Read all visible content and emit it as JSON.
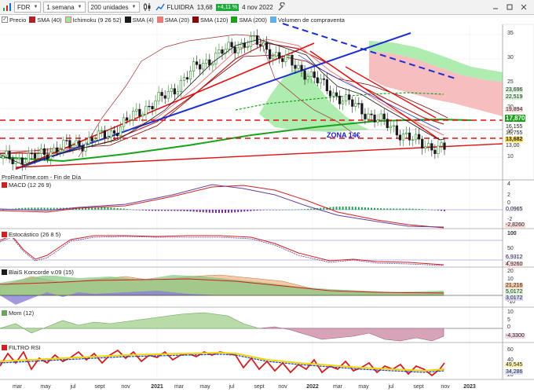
{
  "toolbar": {
    "symbol": "FDR",
    "timeframe": "1 semana",
    "units": "200 unidades",
    "instrument_name": "FLUIDRA",
    "last_price": "13,68",
    "change_pct": "+4,11 %",
    "date": "4 nov 2022"
  },
  "legend": {
    "price": "Precio",
    "sma40": "SMA (40)",
    "ichimoku": "Ichimoku (9 26 52)",
    "sma4": "SMA (4)",
    "sma20": "SMA (20)",
    "sma120": "SMA (120)",
    "sma200": "SMA (200)",
    "volume": "Volumen de compraventa"
  },
  "colors": {
    "candle_up": "#2e8b2e",
    "candle_down": "#1a1a1a",
    "sma4": "#1a1a1a",
    "sma20": "#e87a7a",
    "sma40": "#b22222",
    "sma120": "#8b0000",
    "sma200": "#1aa31a",
    "cloud_green": "#9be79b",
    "cloud_red": "#f5b3b3",
    "trend_red": "#e01010",
    "trend_blue": "#1a2fd0",
    "brand_green": "#1faa3c"
  },
  "annotation": {
    "zona": "ZONA 14€"
  },
  "watermark": "ProRealTime.com - Fin de Día",
  "price_axis": {
    "ticks": [
      "35",
      "30",
      "25",
      "20",
      "15",
      "10"
    ],
    "tags": [
      "23,696",
      "22,519",
      "19,894",
      "17,870",
      "16,155",
      "15,755",
      "13,682",
      "13,00"
    ]
  },
  "macd": {
    "title": "MACD (12 26 9)",
    "ticks": [
      "4",
      "2",
      "0",
      "-2"
    ],
    "tags": [
      "0,0965",
      "-2,8260"
    ]
  },
  "stoch": {
    "title": "Estocástico (26 8 5)",
    "ticks": [
      "100",
      "50",
      "0"
    ],
    "tags": [
      "6,9312",
      "4,9260"
    ]
  },
  "koncorde": {
    "title": "BlaiS Koncorde v.09 (15)",
    "ticks": [
      "20",
      "10",
      "0",
      "-10"
    ],
    "tags": [
      "21,216",
      "5,0172",
      "3,0172"
    ]
  },
  "mom": {
    "title": "Mom (12)",
    "ticks": [
      "10",
      "5",
      "0"
    ],
    "tags": [
      "-4,3300"
    ]
  },
  "rsi": {
    "title": "FILTRO RSI",
    "ticks": [
      "60",
      "40",
      "20"
    ],
    "tags": [
      "49,545",
      "34,286"
    ]
  },
  "x_axis": [
    "mar",
    "may",
    "jul",
    "sept",
    "nov",
    "2021",
    "mar",
    "may",
    "jul",
    "sept",
    "nov",
    "2022",
    "mar",
    "may",
    "jul",
    "sept",
    "nov",
    "2023"
  ],
  "chart_data": {
    "type": "candlestick",
    "title": "FDR",
    "period": "weekly",
    "x": [
      "2020-03",
      "2020-05",
      "2020-07",
      "2020-09",
      "2020-11",
      "2021-01",
      "2021-03",
      "2021-05",
      "2021-07",
      "2021-09",
      "2021-11",
      "2022-01",
      "2022-03",
      "2022-05",
      "2022-07",
      "2022-09",
      "2022-11"
    ],
    "close_approx": [
      12,
      12,
      14,
      15,
      17,
      21,
      24,
      29,
      32,
      34,
      31,
      28,
      24,
      21,
      18,
      15,
      13.68
    ],
    "ylim": [
      8,
      37
    ]
  }
}
